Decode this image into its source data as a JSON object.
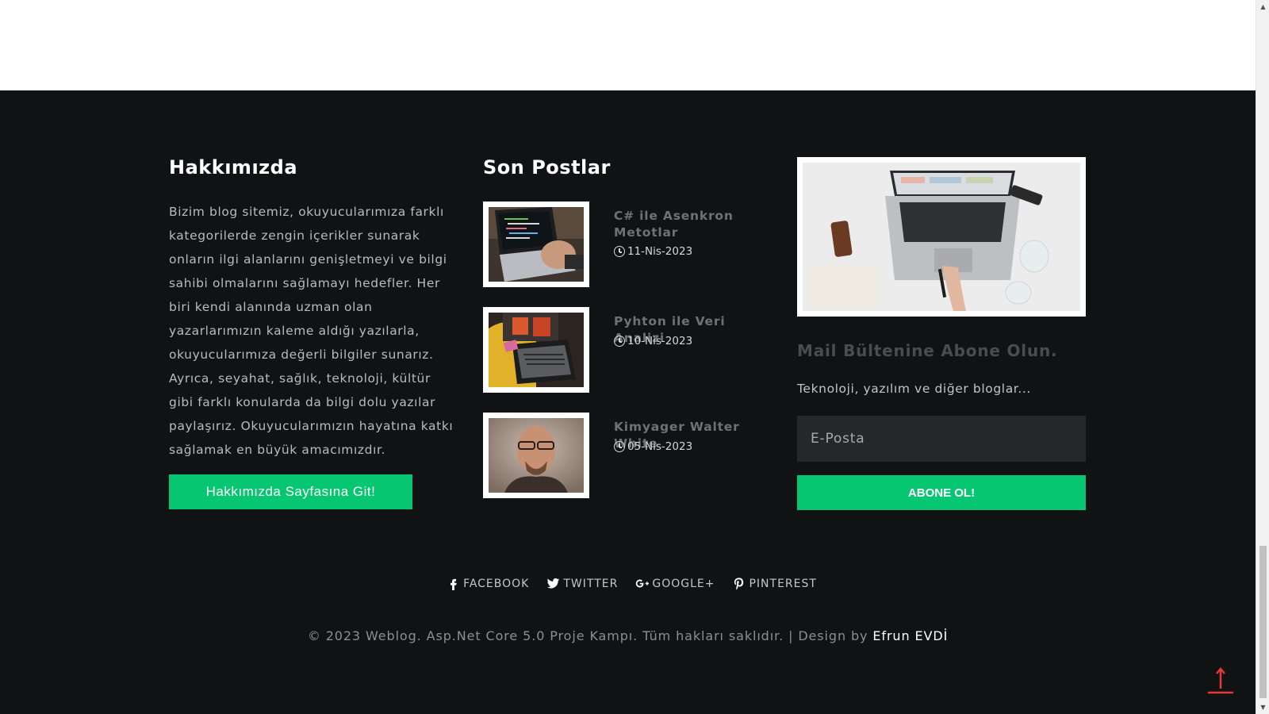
{
  "about": {
    "title": "Hakkımızda",
    "text": "Bizim blog sitemiz, okuyucularımıza farklı kategorilerde zengin içerikler sunarak onların ilgi alanlarını genişletmeyi ve bilgi sahibi olmalarını sağlamayı hedefler. Her biri kendi alanında uzman olan yazarlarımızın kaleme aldığı yazılarla, okuyucularımıza değerli bilgiler sunarız. Ayrıca, seyahat, sağlık, teknoloji, kültür gibi farklı konularda da bilgi dolu yazılar paylaşırız. Okuyucularımızın hayatına katkı sağlamak en büyük amacımızdır.",
    "button_label": "Hakkımızda Sayfasına Git!"
  },
  "posts": {
    "title": "Son Postlar",
    "items": [
      {
        "title": "C# ile Asenkron Metotlar",
        "date": "11-Nis-2023"
      },
      {
        "title": "Pyhton ile Veri Analizi",
        "date": "10-Nis-2023"
      },
      {
        "title": "Kimyager Walter White",
        "date": "05-Nis-2023"
      }
    ]
  },
  "newsletter": {
    "title": "Mail Bültenine Abone Olun.",
    "description": "Teknoloji, yazılım ve diğer bloglar...",
    "email_placeholder": "E-Posta",
    "email_value": "",
    "button_label": "ABONE OL!"
  },
  "social": {
    "facebook": "FACEBOOK",
    "twitter": "TWITTER",
    "google": "GOOGLE+",
    "pinterest": "PINTEREST"
  },
  "footer": {
    "copyright": "© 2023 Weblog. Asp.Net Core 5.0 Proje Kampı. Tüm hakları saklıdır. | Design by",
    "author": "Efrun EVDİ"
  },
  "colors": {
    "background": "#111214",
    "accent_green": "#07c672",
    "to_top_red": "#e53935"
  },
  "icons": {
    "clock": "clock-icon",
    "facebook": "facebook-icon",
    "twitter": "twitter-icon",
    "google": "google-plus-icon",
    "pinterest": "pinterest-icon",
    "to_top": "arrow-up-icon"
  }
}
